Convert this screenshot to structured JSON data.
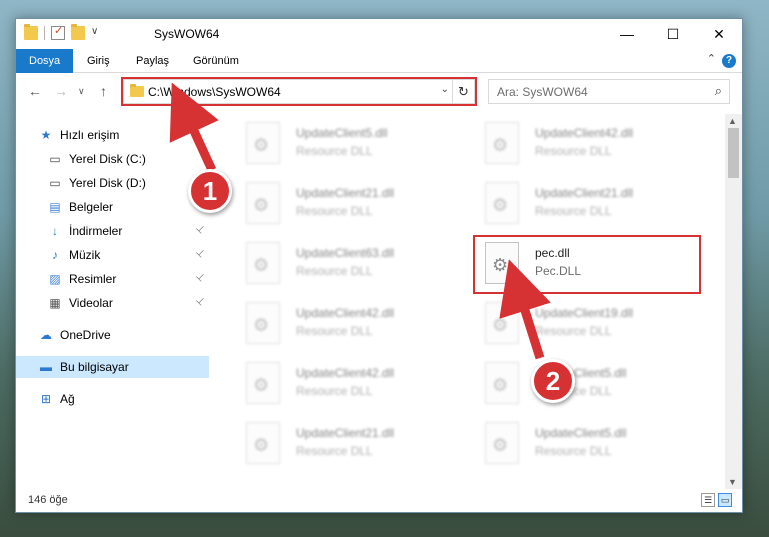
{
  "window": {
    "title": "SysWOW64",
    "minimize": "—",
    "maximize": "☐",
    "close": "✕"
  },
  "ribbon": {
    "tabs": [
      "Dosya",
      "Giriş",
      "Paylaş",
      "Görünüm"
    ],
    "help": "?",
    "collapse": "⌃"
  },
  "nav": {
    "back": "←",
    "forward": "→",
    "dropdown": "∨",
    "up": "↑",
    "address": "C:\\Windows\\SysWOW64",
    "address_dropdown": "⌄",
    "refresh": "↻",
    "search_placeholder": "Ara: SysWOW64",
    "search_icon": "⌕"
  },
  "sidebar": {
    "items": [
      {
        "label": "Hızlı erişim",
        "icon": "star-icon",
        "glyph": "★",
        "color": "#2b79d1"
      },
      {
        "label": "Yerel Disk (C:)",
        "icon": "drive-c-icon",
        "glyph": "▭",
        "color": "#4a4a4a"
      },
      {
        "label": "Yerel Disk (D:)",
        "icon": "drive-d-icon",
        "glyph": "▭",
        "color": "#4a4a4a"
      },
      {
        "label": "Belgeler",
        "icon": "documents-icon",
        "glyph": "▤",
        "color": "#3b7fd4",
        "pinned": true
      },
      {
        "label": "İndirmeler",
        "icon": "downloads-icon",
        "glyph": "↓",
        "color": "#2b79d1",
        "pinned": true
      },
      {
        "label": "Müzik",
        "icon": "music-icon",
        "glyph": "♪",
        "color": "#2b79d1",
        "pinned": true
      },
      {
        "label": "Resimler",
        "icon": "pictures-icon",
        "glyph": "▨",
        "color": "#3b7fd4",
        "pinned": true
      },
      {
        "label": "Videolar",
        "icon": "videos-icon",
        "glyph": "▦",
        "color": "#555",
        "pinned": true
      },
      {
        "label": "OneDrive",
        "icon": "cloud-icon",
        "glyph": "☁",
        "color": "#2b79d1"
      },
      {
        "label": "Bu bilgisayar",
        "icon": "computer-icon",
        "glyph": "▬",
        "color": "#2b79d1",
        "selected": true
      },
      {
        "label": "Ağ",
        "icon": "network-icon",
        "glyph": "⊞",
        "color": "#2b79d1"
      }
    ],
    "pin_glyph": "📌"
  },
  "files": [
    {
      "name": "UpdateClient5.dll",
      "type": "Resource DLL"
    },
    {
      "name": "UpdateClient42.dll",
      "type": "Resource DLL"
    },
    {
      "name": "UpdateClient21.dll",
      "type": "Resource DLL"
    },
    {
      "name": "UpdateClient21.dll",
      "type": "Resource DLL"
    },
    {
      "name": "UpdateClient63.dll",
      "type": "Resource DLL"
    },
    {
      "name": "pec.dll",
      "type": "Pec.DLL",
      "highlighted": true
    },
    {
      "name": "UpdateClient42.dll",
      "type": "Resource DLL"
    },
    {
      "name": "UpdateClient19.dll",
      "type": "Resource DLL"
    },
    {
      "name": "UpdateClient42.dll",
      "type": "Resource DLL"
    },
    {
      "name": "UpdateClient5.dll",
      "type": "Resource DLL"
    },
    {
      "name": "UpdateClient21.dll",
      "type": "Resource DLL"
    },
    {
      "name": "UpdateClient5.dll",
      "type": "Resource DLL"
    }
  ],
  "status": {
    "count": "146 öğe",
    "details_view": "☰",
    "tiles_view": "▭"
  },
  "annotations": {
    "step1": "1",
    "step2": "2",
    "color": "#d63234"
  }
}
